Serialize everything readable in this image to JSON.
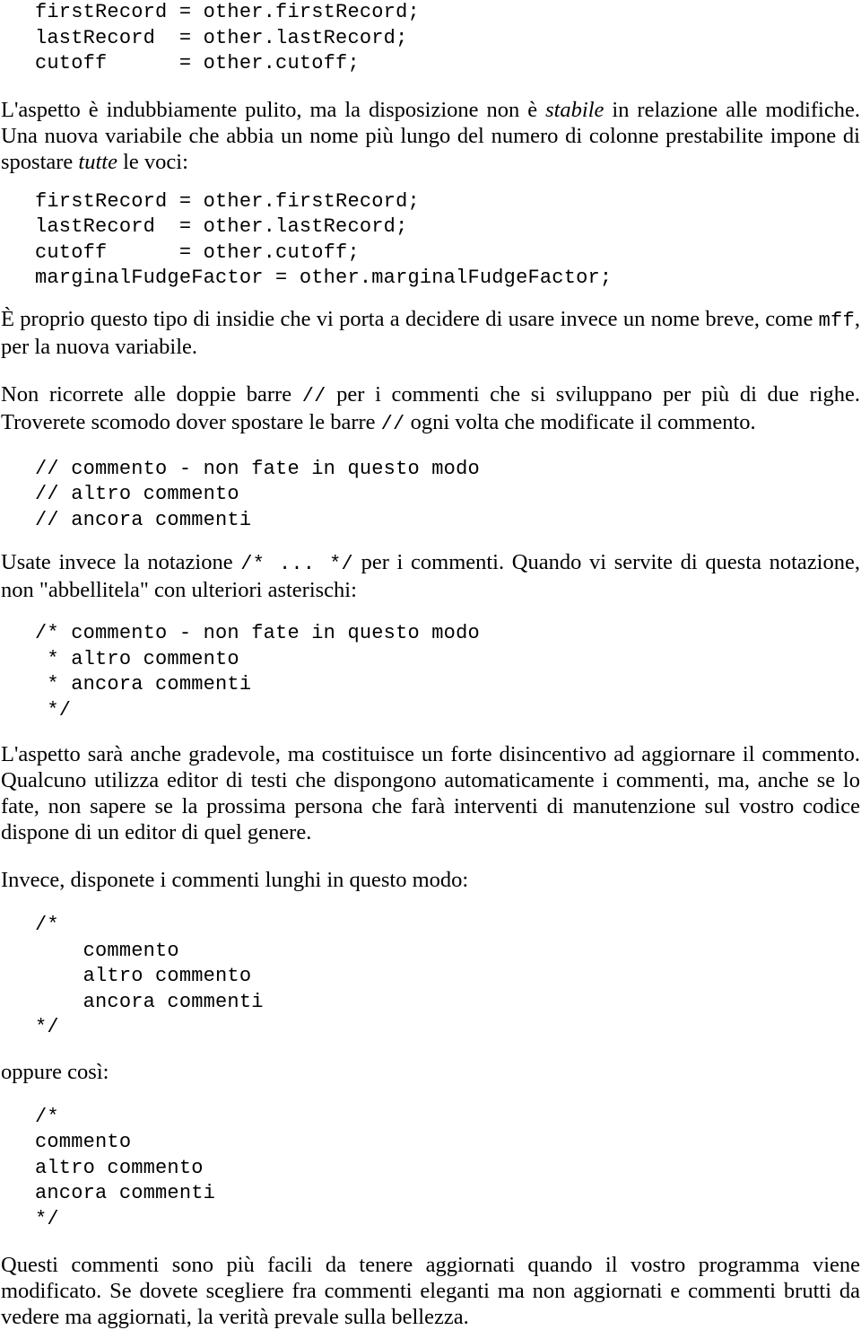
{
  "document": {
    "language": "it",
    "blocks": [
      {
        "kind": "code",
        "name": "code-block-three-fields",
        "text": "firstRecord = other.firstRecord;\nlastRecord  = other.lastRecord;\ncutoff      = other.cutoff;"
      },
      {
        "kind": "prose",
        "name": "paragraph-aspetto-pulito",
        "runs": [
          {
            "style": "plain",
            "text": "L'aspetto è indubbiamente pulito, ma la disposizione non è "
          },
          {
            "style": "italic",
            "text": "stabile"
          },
          {
            "style": "plain",
            "text": " in relazione alle modifiche. Una nuova variabile che abbia un nome più lungo del numero di colonne prestabilite impone di spostare "
          },
          {
            "style": "italic",
            "text": "tutte"
          },
          {
            "style": "plain",
            "text": " le voci:"
          }
        ]
      },
      {
        "kind": "code",
        "name": "code-block-four-fields",
        "text": "firstRecord = other.firstRecord;\nlastRecord  = other.lastRecord;\ncutoff      = other.cutoff;\nmarginalFudgeFactor = other.marginalFudgeFactor;"
      },
      {
        "kind": "prose",
        "name": "paragraph-insidie-nome-breve",
        "runs": [
          {
            "style": "plain",
            "text": "È proprio questo tipo di insidie che vi porta a decidere di usare invece un nome breve, come "
          },
          {
            "style": "mono",
            "text": "mff"
          },
          {
            "style": "plain",
            "text": ", per la nuova variabile."
          }
        ]
      },
      {
        "kind": "prose",
        "name": "paragraph-non-ricorrete-doppie-barre",
        "runs": [
          {
            "style": "plain",
            "text": "Non ricorrete alle doppie barre "
          },
          {
            "style": "mono",
            "text": "//"
          },
          {
            "style": "plain",
            "text": " per i commenti che si sviluppano per più di due righe. Troverete scomodo dover spostare le barre "
          },
          {
            "style": "mono",
            "text": "//"
          },
          {
            "style": "plain",
            "text": " ogni volta che modificate il commento."
          }
        ]
      },
      {
        "kind": "code",
        "name": "code-block-slash-slash-comments",
        "text": "// commento - non fate in questo modo\n// altro commento\n// ancora commenti"
      },
      {
        "kind": "prose",
        "name": "paragraph-usate-notazione-slash-star",
        "runs": [
          {
            "style": "plain",
            "text": "Usate invece la notazione "
          },
          {
            "style": "mono",
            "text": "/*  ...  */"
          },
          {
            "style": "plain",
            "text": " per i commenti. Quando vi servite di questa notazione, non \"abbellitela\" con ulteriori asterischi:"
          }
        ]
      },
      {
        "kind": "code",
        "name": "code-block-starred-comment-bad",
        "text": "/* commento - non fate in questo modo\n * altro commento\n * ancora commenti\n */"
      },
      {
        "kind": "prose",
        "name": "paragraph-aspetto-gradevole-disincentivo",
        "runs": [
          {
            "style": "plain",
            "text": "L'aspetto sarà anche gradevole, ma costituisce un forte disincentivo ad aggiornare il commento. Qualcuno utilizza editor di testi che dispongono automaticamente i commenti, ma, anche se lo fate, non sapere se la prossima persona che farà interventi di manutenzione sul vostro codice dispone di un editor di quel genere."
          }
        ]
      },
      {
        "kind": "prose",
        "name": "paragraph-invece-disponete",
        "runs": [
          {
            "style": "plain",
            "text": "Invece, disponete i commenti lunghi in questo modo:"
          }
        ]
      },
      {
        "kind": "code",
        "name": "code-block-long-comment-indented",
        "text": "/*\n    commento\n    altro commento\n    ancora commenti\n*/"
      },
      {
        "kind": "prose",
        "name": "paragraph-oppure-cosi",
        "runs": [
          {
            "style": "plain",
            "text": "oppure così:"
          }
        ]
      },
      {
        "kind": "code",
        "name": "code-block-long-comment-flush",
        "text": "/*\ncommento\naltro commento\nancora commenti\n*/"
      },
      {
        "kind": "prose",
        "name": "paragraph-questi-commenti-aggiornati",
        "runs": [
          {
            "style": "plain",
            "text": "Questi commenti sono più facili da tenere aggiornati quando il vostro programma viene modificato. Se dovete scegliere fra commenti eleganti ma non aggiornati e commenti brutti da vedere ma aggiornati, la verità prevale sulla bellezza."
          }
        ]
      }
    ]
  },
  "colors": {
    "page_background": "#ffffff",
    "text": "#000000"
  }
}
